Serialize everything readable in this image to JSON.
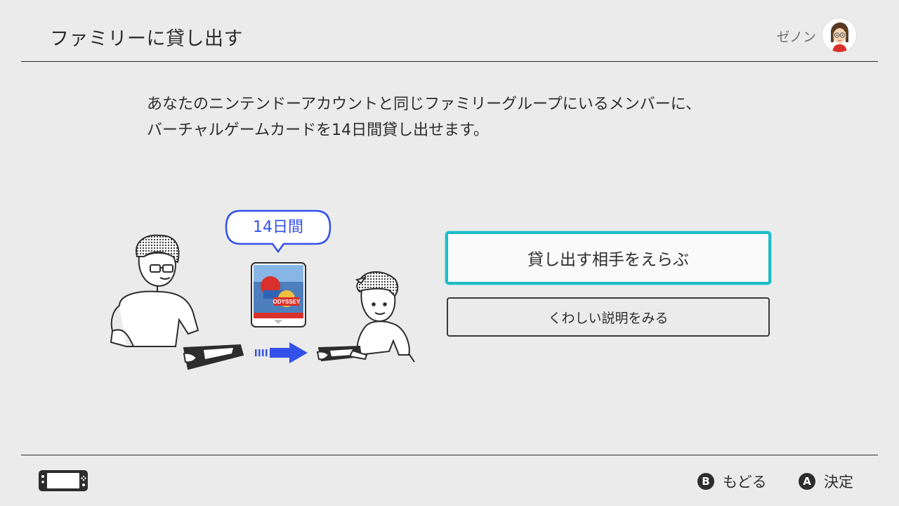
{
  "header": {
    "title": "ファミリーに貸し出す",
    "user_name": "ゼノン"
  },
  "description": {
    "line1": "あなたのニンテンドーアカウントと同じファミリーグループにいるメンバーに、",
    "line2": "バーチャルゲームカードを14日間貸し出せます。"
  },
  "illustration": {
    "bubble_label": "14日間",
    "game_card_logo": "MARIO ODYSSEY"
  },
  "actions": {
    "choose_partner_label": "貸し出す相手をえらぶ",
    "details_label": "くわしい説明をみる"
  },
  "footer": {
    "back": {
      "button": "B",
      "label": "もどる"
    },
    "confirm": {
      "button": "A",
      "label": "決定"
    }
  },
  "colors": {
    "background": "#ebebeb",
    "accent_cyan": "#1fbcc7",
    "bubble_blue": "#3350e8",
    "text": "#2d2d2d"
  },
  "icons": [
    "avatar",
    "console-handheld-icon",
    "b-button-icon",
    "a-button-icon",
    "transfer-arrow-icon"
  ]
}
